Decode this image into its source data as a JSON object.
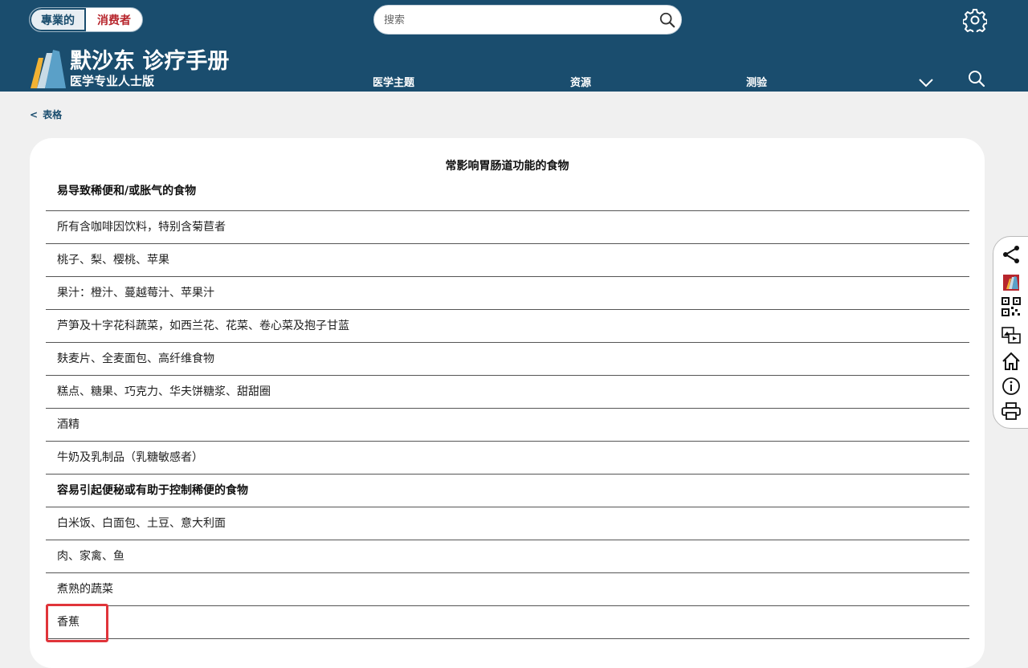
{
  "header": {
    "audience_toggle": {
      "professional": "專業的",
      "consumer": "消费者"
    },
    "search": {
      "placeholder": "搜索"
    },
    "brand": {
      "title": "默沙东 诊疗手册",
      "subtitle": "医学专业人士版"
    },
    "nav": [
      {
        "label": "医学主题"
      },
      {
        "label": "资源"
      },
      {
        "label": "测验"
      }
    ]
  },
  "breadcrumb": {
    "back_symbol": "<",
    "label": "表格"
  },
  "table": {
    "caption": "常影响胃肠道功能的食物",
    "rows": [
      {
        "text": "易导致稀便和/或胀气的食物",
        "section": true
      },
      {
        "text": "所有含咖啡因饮料，特别含菊苣者"
      },
      {
        "text": "桃子、梨、樱桃、苹果"
      },
      {
        "text": "果汁：橙汁、蔓越莓汁、苹果汁"
      },
      {
        "text": "芦笋及十字花科蔬菜，如西兰花、花菜、卷心菜及抱子甘蓝"
      },
      {
        "text": "麸麦片、全麦面包、高纤维食物"
      },
      {
        "text": "糕点、糖果、巧克力、华夫饼糖浆、甜甜圈"
      },
      {
        "text": "酒精"
      },
      {
        "text": "牛奶及乳制品（乳糖敏感者）"
      },
      {
        "text": "容易引起便秘或有助于控制稀便的食物",
        "section": true
      },
      {
        "text": "白米饭、白面包、土豆、意大利面"
      },
      {
        "text": "肉、家禽、鱼"
      },
      {
        "text": "煮熟的蔬菜"
      },
      {
        "text": "香蕉"
      }
    ]
  },
  "side_toolbar": [
    "share-icon",
    "app-logo-icon",
    "qr-code-icon",
    "media-icon",
    "home-icon",
    "info-icon",
    "print-icon"
  ],
  "colors": {
    "header_bg": "#1a4d6e",
    "accent_red": "#b7252c",
    "highlight": "#e0343a",
    "page_bg": "#f0f0f0"
  }
}
